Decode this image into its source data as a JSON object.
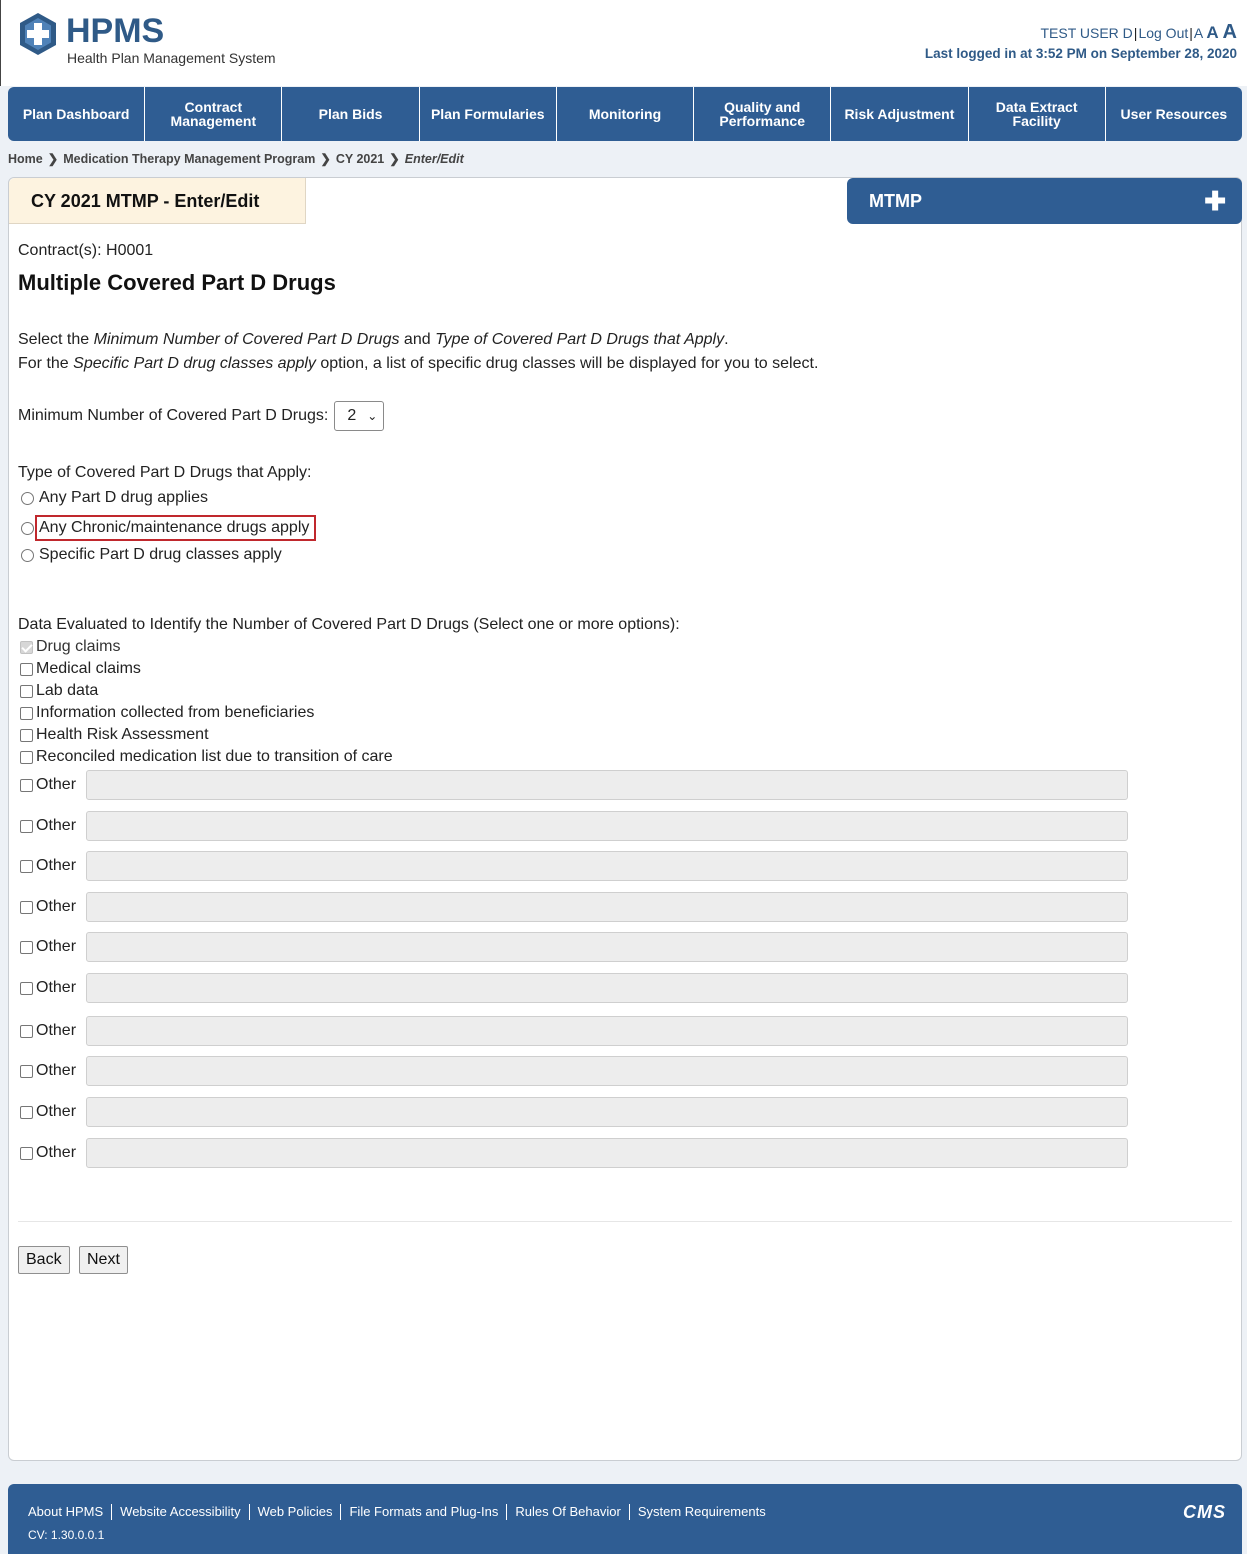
{
  "header": {
    "logo_title": "HPMS",
    "logo_subtitle": "Health Plan Management System",
    "user_name": "TEST USER D",
    "logout_label": "Log Out",
    "font_small": "A",
    "font_medium": "A",
    "font_large": "A",
    "last_login": "Last logged in at 3:52 PM on September 28, 2020"
  },
  "nav": {
    "items": [
      {
        "label": "Plan Dashboard"
      },
      {
        "label": "Contract Management"
      },
      {
        "label": "Plan Bids"
      },
      {
        "label": "Plan Formularies"
      },
      {
        "label": "Monitoring"
      },
      {
        "label": "Quality and Performance"
      },
      {
        "label": "Risk Adjustment"
      },
      {
        "label": "Data Extract Facility"
      },
      {
        "label": "User Resources"
      }
    ]
  },
  "breadcrumb": {
    "home": "Home",
    "program": "Medication Therapy Management Program",
    "year": "CY 2021",
    "current": "Enter/Edit"
  },
  "page": {
    "tab_title": "CY 2021 MTMP - Enter/Edit",
    "side_box_title": "MTMP",
    "side_box_icon": "plus-icon",
    "contracts_label": "Contract(s):",
    "contracts_value": "H0001",
    "heading": "Multiple Covered Part D Drugs",
    "instr1_a": "Select the ",
    "instr1_b": "Minimum Number of Covered Part D Drugs",
    "instr1_c": " and ",
    "instr1_d": "Type of Covered Part D Drugs that Apply",
    "instr1_e": ".",
    "instr2_a": "For the ",
    "instr2_b": "Specific Part D drug classes apply",
    "instr2_c": " option, a list of specific drug classes will be displayed for you to select.",
    "min_label": "Minimum Number of Covered Part D Drugs:",
    "min_value": "2",
    "type_label": "Type of Covered Part D Drugs that Apply:",
    "type_options": [
      {
        "label": "Any Part D drug applies",
        "selected": false
      },
      {
        "label": "Any Chronic/maintenance drugs apply",
        "selected": false
      },
      {
        "label": "Specific Part D drug classes apply",
        "selected": false
      }
    ],
    "data_label": "Data Evaluated to Identify the Number of Covered Part D Drugs (Select one or more options):",
    "data_options": [
      {
        "label": "Drug claims",
        "checked": true,
        "disabled": true
      },
      {
        "label": "Medical claims",
        "checked": false
      },
      {
        "label": "Lab data",
        "checked": false
      },
      {
        "label": "Information collected from beneficiaries",
        "checked": false
      },
      {
        "label": "Health Risk Assessment",
        "checked": false
      },
      {
        "label": "Reconciled medication list due to transition of care",
        "checked": false
      }
    ],
    "other_label": "Other",
    "other_values": [
      "",
      "",
      "",
      "",
      "",
      "",
      "",
      "",
      "",
      ""
    ],
    "back_label": "Back",
    "next_label": "Next"
  },
  "footer": {
    "links": [
      {
        "label": "About HPMS"
      },
      {
        "label": "Website Accessibility"
      },
      {
        "label": "Web Policies"
      },
      {
        "label": "File Formats and Plug-Ins"
      },
      {
        "label": "Rules Of Behavior"
      },
      {
        "label": "System Requirements"
      }
    ],
    "cv": "CV: 1.30.0.0.1",
    "logo_text": "CMS"
  },
  "colors": {
    "brand_blue": "#2f5d93",
    "highlight_red": "#c0282d",
    "tab_bg": "#fdf3e0"
  }
}
